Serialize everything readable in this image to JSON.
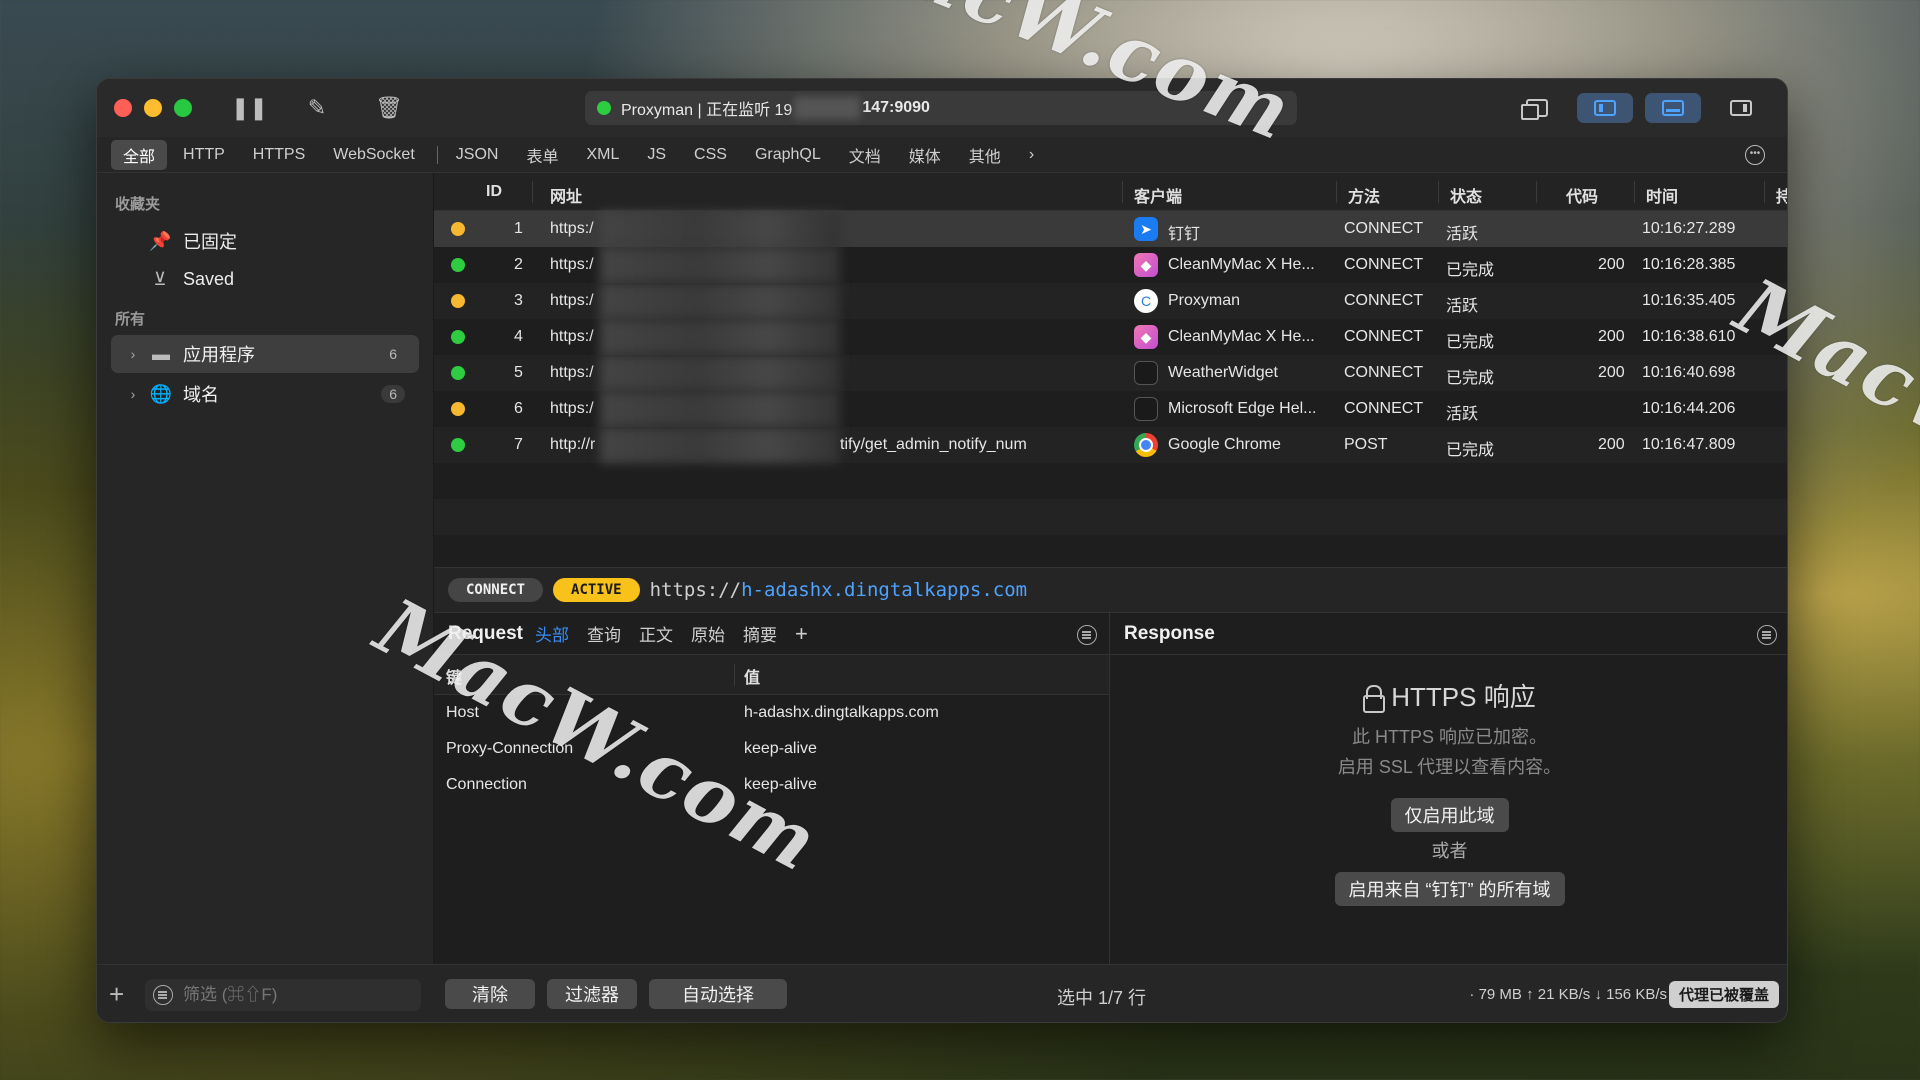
{
  "watermark": "MacW.com",
  "titlebar": {
    "address_prefix": "Proxyman | 正在监听 19",
    "address_suffix": "147:9090",
    "status_color": "#2ecc40"
  },
  "filters": [
    "全部",
    "HTTP",
    "HTTPS",
    "WebSocket",
    "JSON",
    "表单",
    "XML",
    "JS",
    "CSS",
    "GraphQL",
    "文档",
    "媒体",
    "其他"
  ],
  "sidebar": {
    "favorites_label": "收藏夹",
    "pinned": "已固定",
    "saved": "Saved",
    "all_label": "所有",
    "apps": {
      "label": "应用程序",
      "count": "6"
    },
    "domains": {
      "label": "域名",
      "count": "6"
    }
  },
  "table": {
    "headers": {
      "id": "ID",
      "url": "网址",
      "client": "客户端",
      "method": "方法",
      "status": "状态",
      "code": "代码",
      "time": "时间",
      "extra": "持"
    },
    "rows": [
      {
        "id": "1",
        "url": "https:/",
        "client": "钉钉",
        "method": "CONNECT",
        "status": "活跃",
        "code": "",
        "time": "10:16:27.289"
      },
      {
        "id": "2",
        "url": "https:/",
        "client": "CleanMyMac X He...",
        "method": "CONNECT",
        "status": "已完成",
        "code": "200",
        "time": "10:16:28.385"
      },
      {
        "id": "3",
        "url": "https:/",
        "client": "Proxyman",
        "method": "CONNECT",
        "status": "活跃",
        "code": "",
        "time": "10:16:35.405"
      },
      {
        "id": "4",
        "url": "https:/",
        "client": "CleanMyMac X He...",
        "method": "CONNECT",
        "status": "已完成",
        "code": "200",
        "time": "10:16:38.610"
      },
      {
        "id": "5",
        "url": "https:/",
        "client": "WeatherWidget",
        "method": "CONNECT",
        "status": "已完成",
        "code": "200",
        "time": "10:16:40.698"
      },
      {
        "id": "6",
        "url": "https:/",
        "client": "Microsoft Edge Hel...",
        "method": "CONNECT",
        "status": "活跃",
        "code": "",
        "time": "10:16:44.206"
      },
      {
        "id": "7",
        "url": "http://r",
        "url_tail": "tify/get_admin_notify_num",
        "client": "Google Chrome",
        "method": "POST",
        "status": "已完成",
        "code": "200",
        "time": "10:16:47.809"
      }
    ]
  },
  "request_bar": {
    "method": "CONNECT",
    "state": "ACTIVE",
    "scheme": "https://",
    "host": "h-adashx.dingtalkapps.com"
  },
  "request": {
    "title": "Request",
    "tabs": [
      "头部",
      "查询",
      "正文",
      "原始",
      "摘要",
      "+"
    ],
    "key_header": "键",
    "value_header": "值",
    "headers": [
      {
        "key": "Host",
        "value": "h-adashx.dingtalkapps.com"
      },
      {
        "key": "Proxy-Connection",
        "value": "keep-alive"
      },
      {
        "key": "Connection",
        "value": "keep-alive"
      }
    ]
  },
  "response": {
    "title": "Response",
    "heading": "HTTPS 响应",
    "line1": "此 HTTPS 响应已加密。",
    "line2": "启用 SSL 代理以查看内容。",
    "btn_domain": "仅启用此域",
    "or": "或者",
    "btn_all": "启用来自 “钉钉” 的所有域"
  },
  "bottom": {
    "search_placeholder": "筛选 (⌘⇧F)",
    "clear": "清除",
    "filter": "过滤器",
    "autoselect": "自动选择",
    "selection": "选中 1/7 行",
    "stats": "· 79 MB ↑ 21 KB/s ↓ 156 KB/s",
    "proxy_badge": "代理已被覆盖"
  }
}
